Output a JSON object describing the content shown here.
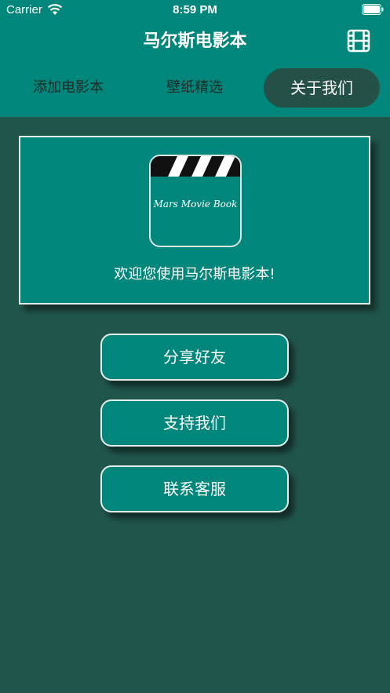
{
  "status_bar": {
    "carrier": "Carrier",
    "time": "8:59 PM"
  },
  "nav": {
    "title": "马尔斯电影本",
    "right_icon": "film-icon"
  },
  "tabs": [
    {
      "label": "添加电影本",
      "selected": false
    },
    {
      "label": "壁纸精选",
      "selected": false
    },
    {
      "label": "关于我们",
      "selected": true
    }
  ],
  "about": {
    "logo_text": "Mars Movie Book",
    "welcome": "欢迎您使用马尔斯电影本!"
  },
  "actions": {
    "share": "分享好友",
    "support": "支持我们",
    "contact": "联系客服"
  },
  "colors": {
    "header": "#00867a",
    "background": "#20554b",
    "tab_selected": "#245047"
  }
}
